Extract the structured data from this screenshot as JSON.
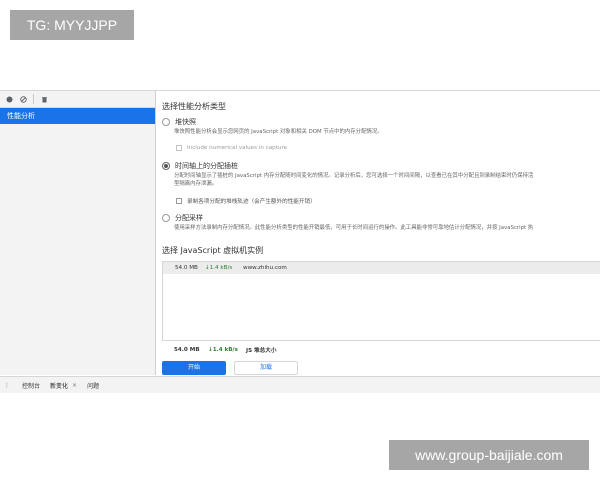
{
  "watermarks": {
    "top": "TG: MYYJJPP",
    "bottom": "www.group-baijiale.com"
  },
  "toolbar": {
    "icons": [
      "record-icon",
      "clear-icon",
      "delete-icon"
    ]
  },
  "sidebar": {
    "items": [
      {
        "label": "性能分析",
        "selected": true
      }
    ]
  },
  "profile_types": {
    "title": "选择性能分析类型",
    "options": [
      {
        "label": "堆快照",
        "selected": false,
        "description": "堆快照性能分析会显示您网页的 JavaScript 对象和相关 DOM 节点中的内存分配情况。",
        "checkbox_label": "Include numerical values in capture",
        "checkbox_checked": false,
        "checkbox_disabled": true
      },
      {
        "label": "时间轴上的分配插桩",
        "selected": true,
        "description": "分配时间轴显示了插桩的 JavaScript 内存分配随时间变化的情况。记录分析后，您可选择一个时间间隔，以查看已在其中分配且到录制结束时仍保持活",
        "description2": "型隔离内存泄漏。",
        "checkbox_label": "录制各项分配的堆栈轨迹（会产生额外的性能开销）",
        "checkbox_checked": false,
        "checkbox_disabled": false
      },
      {
        "label": "分配采样",
        "selected": false,
        "description": "使用采样方法录制内存分配情况。此性能分析类型的性能开销最低，可用于长时间运行的操作。此工具能非常可靠地估计分配情况，并按 JavaScript 执"
      }
    ]
  },
  "vm": {
    "title": "选择 JavaScript 虚拟机实例",
    "instances": [
      {
        "size": "54.0 MB",
        "rate": "1.4 kB/s",
        "name": "www.zhihu.com"
      }
    ],
    "total": {
      "size": "54.0 MB",
      "rate": "1.4 kB/s",
      "label": "JS 堆总大小"
    }
  },
  "actions": {
    "start": "开始",
    "load": "加载"
  },
  "drawer": {
    "tabs": [
      {
        "label": "控制台",
        "active": false
      },
      {
        "label": "新变化",
        "active": true
      },
      {
        "label": "问题",
        "active": false
      }
    ],
    "close": "×",
    "menu": "⋮"
  },
  "colors": {
    "accent": "#1a73e8",
    "rate_green": "#2e7d32",
    "watermark_bg": "#a6a6a6"
  }
}
